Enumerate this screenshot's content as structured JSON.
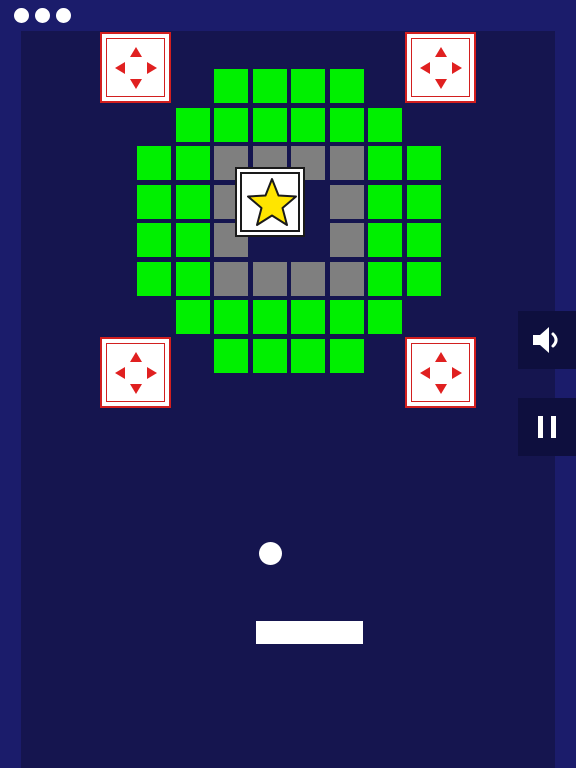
{
  "colors": {
    "background": "#1b1c6b",
    "playfield": "#15154f",
    "green_brick": "#00f000",
    "gray_brick": "#7f7f7f",
    "star": "#ffe500",
    "arrow": "#e02020",
    "control_bg": "#0e0f3e"
  },
  "top_bar": {
    "menu_icon": "more-dots-icon"
  },
  "bricks": [
    {
      "type": "green",
      "row": 0,
      "col": 2
    },
    {
      "type": "green",
      "row": 0,
      "col": 3
    },
    {
      "type": "green",
      "row": 0,
      "col": 4
    },
    {
      "type": "green",
      "row": 0,
      "col": 5
    },
    {
      "type": "green",
      "row": 1,
      "col": 1
    },
    {
      "type": "green",
      "row": 1,
      "col": 2
    },
    {
      "type": "green",
      "row": 1,
      "col": 3
    },
    {
      "type": "green",
      "row": 1,
      "col": 4
    },
    {
      "type": "green",
      "row": 1,
      "col": 5
    },
    {
      "type": "green",
      "row": 1,
      "col": 6
    },
    {
      "type": "green",
      "row": 2,
      "col": 0
    },
    {
      "type": "green",
      "row": 2,
      "col": 1
    },
    {
      "type": "gray",
      "row": 2,
      "col": 2
    },
    {
      "type": "gray",
      "row": 2,
      "col": 3
    },
    {
      "type": "gray",
      "row": 2,
      "col": 4
    },
    {
      "type": "gray",
      "row": 2,
      "col": 5
    },
    {
      "type": "green",
      "row": 2,
      "col": 6
    },
    {
      "type": "green",
      "row": 2,
      "col": 7
    },
    {
      "type": "green",
      "row": 3,
      "col": 0
    },
    {
      "type": "green",
      "row": 3,
      "col": 1
    },
    {
      "type": "gray",
      "row": 3,
      "col": 2
    },
    {
      "type": "gray",
      "row": 3,
      "col": 5
    },
    {
      "type": "green",
      "row": 3,
      "col": 6
    },
    {
      "type": "green",
      "row": 3,
      "col": 7
    },
    {
      "type": "green",
      "row": 4,
      "col": 0
    },
    {
      "type": "green",
      "row": 4,
      "col": 1
    },
    {
      "type": "gray",
      "row": 4,
      "col": 2
    },
    {
      "type": "gray",
      "row": 4,
      "col": 5
    },
    {
      "type": "green",
      "row": 4,
      "col": 6
    },
    {
      "type": "green",
      "row": 4,
      "col": 7
    },
    {
      "type": "green",
      "row": 5,
      "col": 0
    },
    {
      "type": "green",
      "row": 5,
      "col": 1
    },
    {
      "type": "gray",
      "row": 5,
      "col": 2
    },
    {
      "type": "gray",
      "row": 5,
      "col": 3
    },
    {
      "type": "gray",
      "row": 5,
      "col": 4
    },
    {
      "type": "gray",
      "row": 5,
      "col": 5
    },
    {
      "type": "green",
      "row": 5,
      "col": 6
    },
    {
      "type": "green",
      "row": 5,
      "col": 7
    },
    {
      "type": "green",
      "row": 6,
      "col": 1
    },
    {
      "type": "green",
      "row": 6,
      "col": 2
    },
    {
      "type": "green",
      "row": 6,
      "col": 3
    },
    {
      "type": "green",
      "row": 6,
      "col": 4
    },
    {
      "type": "green",
      "row": 6,
      "col": 5
    },
    {
      "type": "green",
      "row": 6,
      "col": 6
    },
    {
      "type": "green",
      "row": 7,
      "col": 2
    },
    {
      "type": "green",
      "row": 7,
      "col": 3
    },
    {
      "type": "green",
      "row": 7,
      "col": 4
    },
    {
      "type": "green",
      "row": 7,
      "col": 5
    }
  ],
  "special_bricks": [
    {
      "type": "star",
      "icon": "star-icon",
      "center_row": 3.5,
      "center_col": 3.5
    },
    {
      "type": "move",
      "icon": "four-arrows-icon",
      "corner": "top-left"
    },
    {
      "type": "move",
      "icon": "four-arrows-icon",
      "corner": "top-right"
    },
    {
      "type": "move",
      "icon": "four-arrows-icon",
      "corner": "bottom-left"
    },
    {
      "type": "move",
      "icon": "four-arrows-icon",
      "corner": "bottom-right"
    }
  ],
  "controls": {
    "sound_icon": "speaker-icon",
    "pause_icon": "pause-icon"
  }
}
